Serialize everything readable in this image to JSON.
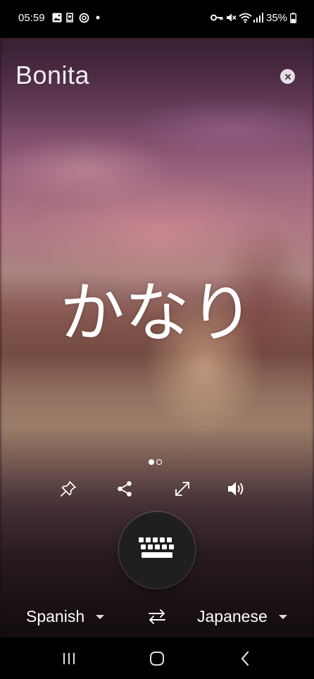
{
  "status_bar": {
    "time": "05:59",
    "battery": "35%",
    "icons_left": [
      "gallery-icon",
      "amazon-icon",
      "sync-icon",
      "dot-icon"
    ],
    "icons_right": [
      "vpn-key-icon",
      "mute-icon",
      "wifi-icon",
      "signal-icon",
      "battery-icon"
    ]
  },
  "header": {
    "source_text": "Bonita",
    "close_icon": "close-icon"
  },
  "translation": {
    "text": "かなり"
  },
  "pager": {
    "current_page": 1,
    "total_pages": 2
  },
  "actions": [
    {
      "name": "pin",
      "icon": "pin-icon"
    },
    {
      "name": "share",
      "icon": "share-icon"
    },
    {
      "name": "fullscreen",
      "icon": "expand-icon"
    },
    {
      "name": "speak",
      "icon": "speaker-icon"
    }
  ],
  "keyboard_button": {
    "icon": "keyboard-icon"
  },
  "languages": {
    "source": "Spanish",
    "target": "Japanese",
    "swap_icon": "swap-icon"
  },
  "nav_bar": {
    "recents_icon": "recents-icon",
    "home_icon": "home-icon",
    "back_icon": "back-icon"
  },
  "colors": {
    "status_bar_bg": "#000000",
    "text": "#ffffff",
    "keyboard_button_bg": "#1f1f1f"
  }
}
